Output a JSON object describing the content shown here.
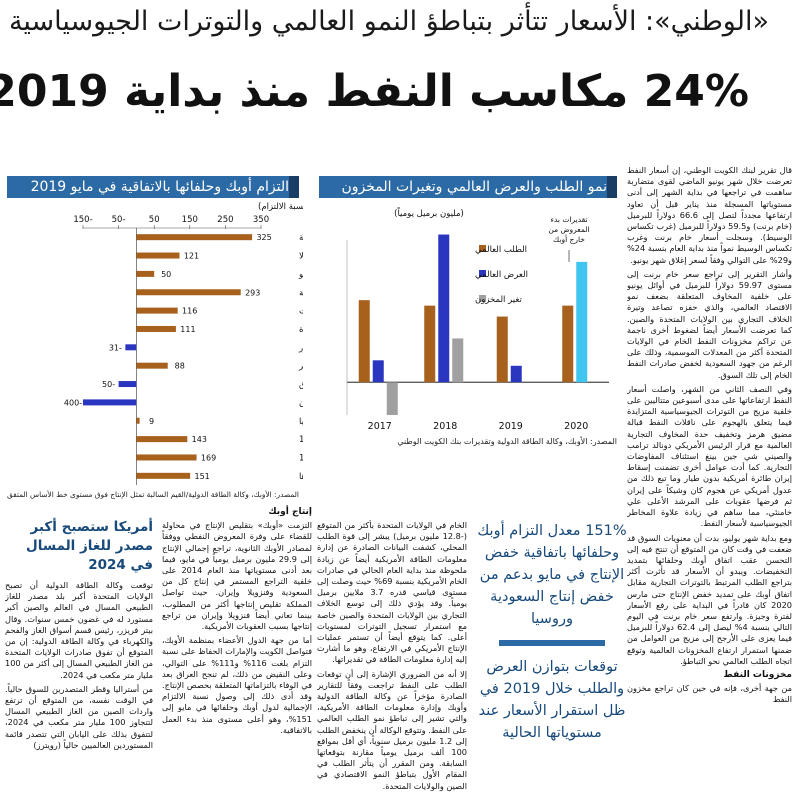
{
  "header": {
    "kicker": "«الوطني»: الأسعار تتأثر بتباطؤ النمو العالمي والتوترات الجيوسياسية",
    "headline": "24% مكاسب النفط منذ بداية 2019"
  },
  "article": {
    "col1_p1": "قال تقرير لبنك الكويت الوطني، إن أسعار النفط تعرضت خلال شهر يونيو الماضي لقوى متضاربة ساهمت في تراجعها في بداية الشهر إلى أدنى مستوياتها المسجلة منذ يناير قبل أن تعاود ارتفاعها مجدداً لتصل إلى 66.6 دولاراً للبرميل (خام برنت) و59.5 دولاراً للبرميل (غرب تكساس الوسيط). وسجلت أسعار خام برنت وغرب تكساس الوسيط نمواً منذ بداية العام بنسبة 24% و29% على التوالي وفقاً لسعر إغلاق شهر يونيو.",
    "col1_p2": "وأشار التقرير إلى تراجع سعر خام برنت إلى مستوى 59.97 دولاراً للبرميل في أوائل يونيو على خلفية المخاوف المتعلقة بضعف نمو الاقتصاد العالمي، والذي حفزه تصاعد وتيرة الخلاف التجاري بين الولايات المتحدة والصين. كما تعرضت الأسعار أيضاً لضغوط أخرى ناجمة عن تراكم مخزونات النفط الخام في الولايات المتحدة أكثر من المعدلات الموسمية، وذلك على الرغم من جهود السعودية لخفض صادرات النفط الخام إلى تلك السوق.",
    "col1_p3": "وفي النصف الثاني من الشهر، واصلت أسعار النفط ارتفاعاتها على مدى أسبوعين متتاليين على خلفية مزيج من التوترات الجيوسياسية المتزايدة فيما يتعلق بالهجوم على ناقلات النفط قبالة مضيق هرمز وتخفيف حدة المخاوف التجارية العالمية مع قرار الرئيس الأمريكي دونالد ترامب والصيني شي جين بينغ استئناف المفاوضات التجارية. كما أدت عوامل أخرى تضمنت إسقاط إيران طائرة أمريكية بدون طيار وما تبع ذلك من عدول أمريكي عن هجوم كان وشيكاً على إيران ثم فرضها عقوبات على المرشد الأعلى علي خامنئي، مما ساهم في زيادة علاوة المخاطر الجيوسياسية لأسعار النفط.",
    "col1_p4": "ومع بداية شهر يوليو، بدت أن معنويات السوق قد ضعفت في وقت كان من المتوقع أن تنتج فيه إلى التحسن عقب اتفاق أوبك وحلفائها بتمديد التخفيضات. ويبدو أن الأسعار قد تأثرت أكثر بتراجع الطلب المرتبط بالتوترات التجارية مقابل اتفاق أوبك على تمديد خفض الإنتاج حتى مارس 2020 كان قادراً في البداية على رفع الأسعار لفترة وجيزة. وارتفع سعر خام برنت في اليوم التالي بنسبة 4% ليصل إلى 62.4 دولاراً للبرميل فيما يعزى على الأرجح إلى مزيج من العوامل من ضمنها استمرار ارتفاع المخزونات العالمية وتوقع اتجاه الطلب العالمي نحو التباطؤ.",
    "col1_sub": "مخزونات النفط",
    "col1_p5": "من جهة أخرى، فإنه في حين كان تراجع مخزون النفط",
    "col2_p1": "الخام في الولايات المتحدة بأكثر من المتوقع (-12.8 مليون برميل) يبشر إلى قوة الطلب المحلي، كشفت البيانات الصادرة عن إدارة معلومات الطاقة الأمريكية أيضاً عن زيادة ملحوظة منذ بداية العام الحالي في صادرات الخام الأمريكية بنسبة 69% حيث وصلت إلى مستوى قياسي قدره 3.7 ملايين برميل يومياً. وقد يؤدي ذلك إلى توسع الخلاف التجاري بين الولايات المتحدة والصين خاصة مع استمرار تسجيل التوترات لمستويات أعلى. كما يتوقع أيضاً أن تستمر عمليات الإنتاج الأمريكي في الارتفاع، وهو ما أشارت إليه إدارة معلومات الطاقة في تقديراتها.",
    "col2_p2": "إلا أنه من الضروري الإشارة إلى أن توقعات الطلب على النفط تراجعت وفقاً للتقارير الصادرة مؤخراً عن وكالة الطاقة الدولية وأوبك وإدارة معلومات الطاقة الأمريكية، والتي تشير إلى تباطؤ نمو الطلب العالمي على النفط. وتتوقع الوكالة أن ينخفض الطلب إلى 1.2 مليون برميل سنوياً، أي أقل بمواقع 100 ألف برميل يومياً مقارنة بتوقعاتها السابقة. ومن المقرر أن يتأثر الطلب في المقام الأول بتباطؤ النمو الاقتصادي في الصين والولايات المتحدة.",
    "col3_sub": "إنتاج أوبك",
    "col3_p1": "التزمت «أوبك» بتقليص الإنتاج في محاولة للقضاء على وفرة المعروض النفطي ووفقاً لمصادر الأوبك الثانوية، تراجع إجمالي الإنتاج إلى 29.9 مليون برميل يومياً في مايو، فيما بعد أدنى مستوياتها منذ العام 2014 على خلفية التراجع المستمر في إنتاج كل من السعودية وفنزويلا وإيران. حيث تواصل المملكة تقليص إنتاجها أكثر من المطلوب، بينما تعاني أيضاً فنزويلا وإيران من تراجع إنتاجها بسبب العقوبات الأمريكية.",
    "col3_p2": "أما من جهة الدول الأعضاء بمنظمة الأوبك، فتواصل الكويت والإمارات الحفاظ على نسبة التزام بلغت 116% و111% على التوالي، وعلى النقيض من ذلك، لم تنجح العراق بعد في الوفاء بالتزاماتها المتعلقة بحصص الإنتاج. وقد أدى ذلك إلى وصول نسبة الالتزام الإجمالية لدول أوبك وحلفائها في مايو إلى 151%، وهو أعلى مستوى منذ بدء العمل بالاتفاقية.",
    "col4_p1": "توقعت وكالة الطاقة الدولية أن تصبح الولايات المتحدة أكبر بلد مصدر للغاز الطبيعي المسال في العالم والصين أكبر مستورد له في غضون خمس سنوات. وقال بيتر فريزر، رئيس قسم أسواق الغاز والفحم والكهرباء في وكالة الطاقة الدولية: إن من المتوقع أن تفوق صادرات الولايات المتحدة من الغاز الطبيعي المسال إلى أكثر من 100 مليار متر مكعب في 2024.",
    "col4_p2": "من أستراليا وقطر المتصدرين للسوق حالياً. في الوقت نفسه، من المتوقع أن ترتفع واردات الصين من الغاز الطبيعي المسال لتتجاوز 100 مليار متر مكعب في 2024، لتتفوق بذلك على اليابان التي تتصدر قائمة المستوردين العالميين حالياً (رويترز)"
  },
  "side_story": {
    "title": "أمريكا ستصبح أكبر مصدر للغاز المسال في 2024"
  },
  "pull_quote": {
    "q1": "151% معدل التزام أوبك وحلفائها باتفاقية خفض الإنتاج في مايو بدعم من خفض إنتاج السعودية وروسيا",
    "q2": "توقعات بتوازن العرض والطلب خلال 2019 في ظل استقرار الأسعار عند مستوياتها الحالية"
  },
  "chart_right": {
    "heading": "نمو الطلب والعرض العالمي وتغيرات المخزون",
    "unit": "(مليون برميل يومياً)",
    "note": "تقديرات بدء المعروض من خارج أوبك",
    "source": "المصدر: الأوبك، وكالة الطاقة الدولية وتقديرات بنك الكويت الوطني"
  },
  "chart_left": {
    "heading": "التزام أوبك وحلفائها بالاتفاقية في مايو 2019",
    "unit": "(% نسبة الالتزام)",
    "source": "المصدر: الأوبك، وكالة الطاقة الدولية/القيم السالبة تمثل الإنتاج فوق مستوى خط الأساس المتفق"
  },
  "chart_data": [
    {
      "type": "bar",
      "title": "نمو الطلب والعرض العالمي وتغيرات المخزون",
      "ylabel": "(مليون برميل يومياً)",
      "categories": [
        "2017",
        "2018",
        "2019",
        "2020"
      ],
      "ylim": [
        -0.6,
        2.6
      ],
      "series": [
        {
          "name": "الطلب العالمي",
          "color": "#a8601d",
          "values": [
            1.5,
            1.4,
            1.2,
            1.4
          ]
        },
        {
          "name": "العرض العالمي",
          "color": "#2a35c0",
          "values": [
            0.4,
            2.7,
            0.3,
            null
          ]
        },
        {
          "name": "تغير المخزون",
          "color": "#a0a0a0",
          "values": [
            -0.6,
            0.8,
            null,
            null
          ]
        },
        {
          "name": "تقديرات بدء المعروض من خارج أوبك",
          "color": "#40c4f0",
          "values": [
            null,
            null,
            null,
            2.2
          ]
        }
      ]
    },
    {
      "type": "bar",
      "orientation": "horizontal",
      "title": "التزام أوبك وحلفائها بالاتفاقية في مايو 2019",
      "xlabel": "(% نسبة الالتزام)",
      "xlim": [
        -150,
        350
      ],
      "xticks": [
        "-150",
        "-50",
        "50",
        "150",
        "250",
        "350"
      ],
      "categories": [
        "غينيا الإستوائية",
        "أنغولا",
        "الكونغو",
        "المملكة العربية السعودية",
        "الكويت",
        "الإمارات العربية المتحدة",
        "الإكوادور",
        "الجزائر",
        "العراق",
        "الغابون",
        "نيجيريا",
        "أوبك 11",
        "حلفاء الأوبك 10",
        "أوبك وحلفاؤها"
      ],
      "values": [
        325,
        121,
        50,
        293,
        116,
        111,
        -31,
        88,
        -50,
        -400,
        9,
        143,
        169,
        151
      ],
      "colors": {
        "positive": "#a8601d",
        "negative": "#2a35c0"
      }
    }
  ]
}
